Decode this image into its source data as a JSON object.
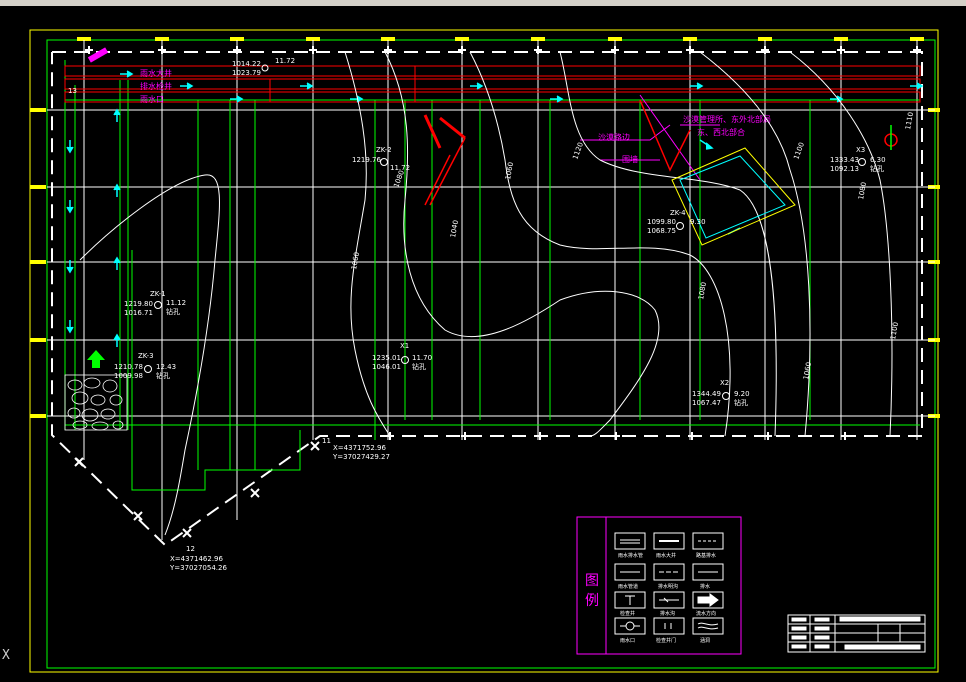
{
  "colors": {
    "background": "#000000",
    "frame": "#ffff00",
    "green": "#00ff00",
    "red": "#ff0000",
    "magenta": "#ff00ff",
    "cyan": "#00ffff",
    "white": "#ffffff"
  },
  "pipes": {
    "label_1": "雨水大井",
    "label_2": "排水检井",
    "label_3": "雨水口"
  },
  "annotations": {
    "purple_1": "沙漠管理所、东外北部局",
    "purple_2": "沙漠路边",
    "purple_3": "东、西北部合",
    "purple_4": "围墙"
  },
  "coords": {
    "tl_1": "1023.79",
    "tl_2": "1014.22",
    "tl_3": "11.72"
  },
  "points": {
    "zk2": {
      "id": "ZK-2",
      "x": "1219.76",
      "elev": "11.72"
    },
    "zk1": {
      "id": "ZK-1",
      "x": "1219.80",
      "y": "1016.71",
      "elev": "11.12",
      "note": "钻孔"
    },
    "zk3": {
      "id": "ZK-3",
      "x": "1210.78",
      "y": "1009.98",
      "elev": "12.43",
      "note": "钻孔"
    },
    "x1": {
      "id": "X1",
      "x": "1235.01",
      "y": "1046.01",
      "elev": "11.70",
      "note": "钻孔"
    },
    "zk4": {
      "id": "ZK-4",
      "x": "1099.80",
      "y": "1068.75",
      "elev": "9.30"
    },
    "x2": {
      "id": "X2",
      "x": "1344.49",
      "y": "1067.47",
      "elev": "9.20",
      "note": "钻孔"
    },
    "x3": {
      "id": "X3",
      "x": "1333.43",
      "y": "1092.13",
      "elev": "6.30",
      "note": "钻孔"
    }
  },
  "contours": [
    "1080",
    "1060",
    "1040",
    "1060",
    "1120",
    "1100",
    "1080",
    "1080",
    "1060",
    "1110",
    "1100"
  ],
  "corners": {
    "c11_label": "11",
    "c11_x": "X=4371752.96",
    "c11_y": "Y=37027429.27",
    "c12_label": "12",
    "c12_x": "X=4371462.96",
    "c12_y": "Y=37027054.26",
    "c13_label": "13"
  },
  "legend": {
    "title_1": "图",
    "title_2": "例",
    "items": [
      "雨水排水管",
      "雨水大井",
      "路基排水",
      "雨水管道",
      "排水明沟",
      "排水",
      "检查井",
      "排水沟",
      "流水方向",
      "雨水口",
      "检查井门",
      "涵洞"
    ]
  },
  "axis_hint": "X"
}
